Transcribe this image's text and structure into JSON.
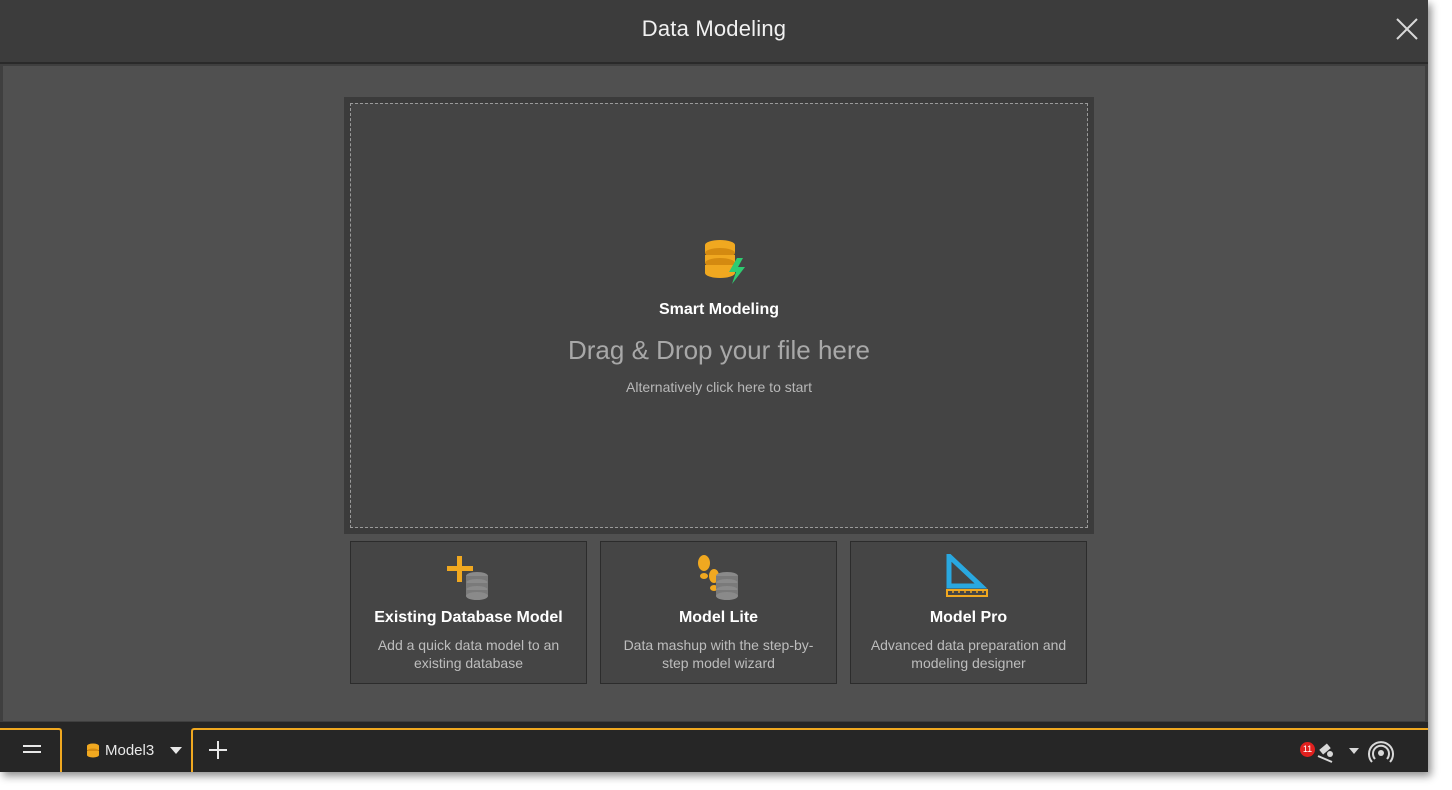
{
  "window": {
    "title": "Data Modeling",
    "close_icon": "close-icon"
  },
  "dropzone": {
    "icon": "smart-database-lightning-icon",
    "title": "Smart Modeling",
    "drag_text": "Drag & Drop your file here",
    "alt_text": "Alternatively click here to start"
  },
  "options": [
    {
      "icon": "database-add-icon",
      "title": "Existing Database Model",
      "description": "Add a quick data model to an existing database"
    },
    {
      "icon": "footsteps-database-icon",
      "title": "Model Lite",
      "description": "Data mashup with the step-by-step model wizard"
    },
    {
      "icon": "set-square-ruler-icon",
      "title": "Model Pro",
      "description": "Advanced data preparation and modeling designer"
    }
  ],
  "taskbar": {
    "menu_icon": "hamburger-icon",
    "tab_label": "Model3",
    "tab_icon": "database-icon",
    "add_icon": "plus-icon",
    "notification_count": "11",
    "status_icon": "satellite-icon",
    "broadcast_icon": "broadcast-icon"
  },
  "colors": {
    "accent": "#f0a820",
    "lightning": "#2ecc71",
    "ruler": "#29a8e0",
    "badge": "#e0201e"
  }
}
